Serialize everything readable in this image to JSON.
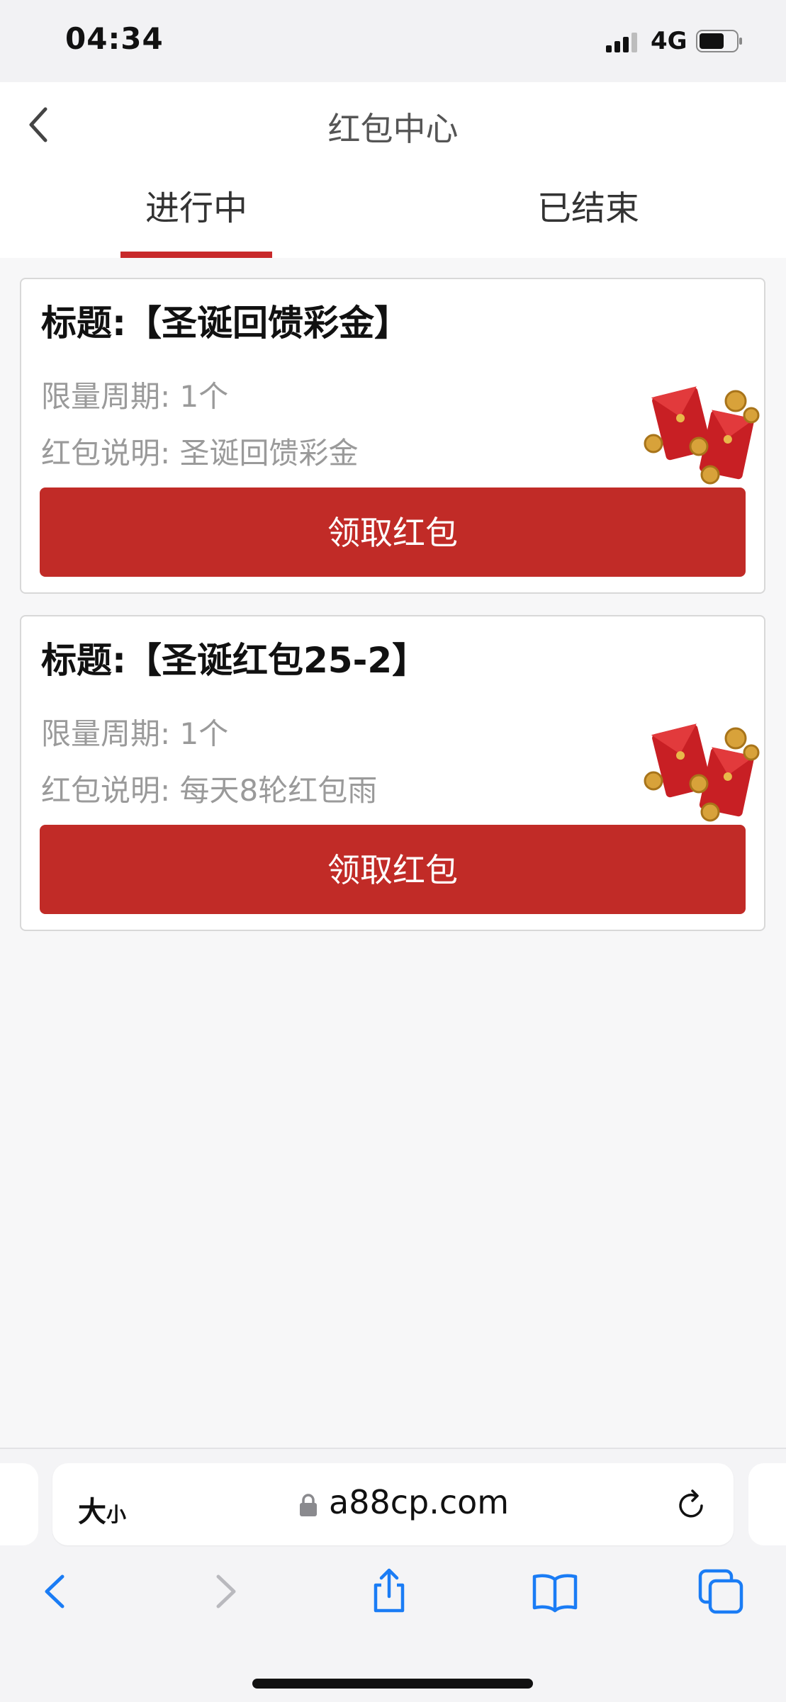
{
  "status_bar": {
    "time": "04:34",
    "network": "4G"
  },
  "header": {
    "title": "红包中心"
  },
  "tabs": [
    {
      "label": "进行中",
      "active": true
    },
    {
      "label": "已结束",
      "active": false
    }
  ],
  "cards": [
    {
      "title": "标题:【圣诞回馈彩金】",
      "limit_label": "限量周期: ",
      "limit_value": "1个",
      "desc_label": "红包说明: ",
      "desc_value": "圣诞回馈彩金",
      "button_label": "领取红包"
    },
    {
      "title": "标题:【圣诞红包25-2】",
      "limit_label": "限量周期: ",
      "limit_value": "1个",
      "desc_label": "红包说明: ",
      "desc_value": "每天8轮红包雨",
      "button_label": "领取红包"
    }
  ],
  "browser": {
    "text_size_label": "大",
    "text_size_small": "小",
    "url": "a88cp.com"
  },
  "colors": {
    "accent": "#c12b27",
    "ios_blue": "#1a7cf5"
  }
}
